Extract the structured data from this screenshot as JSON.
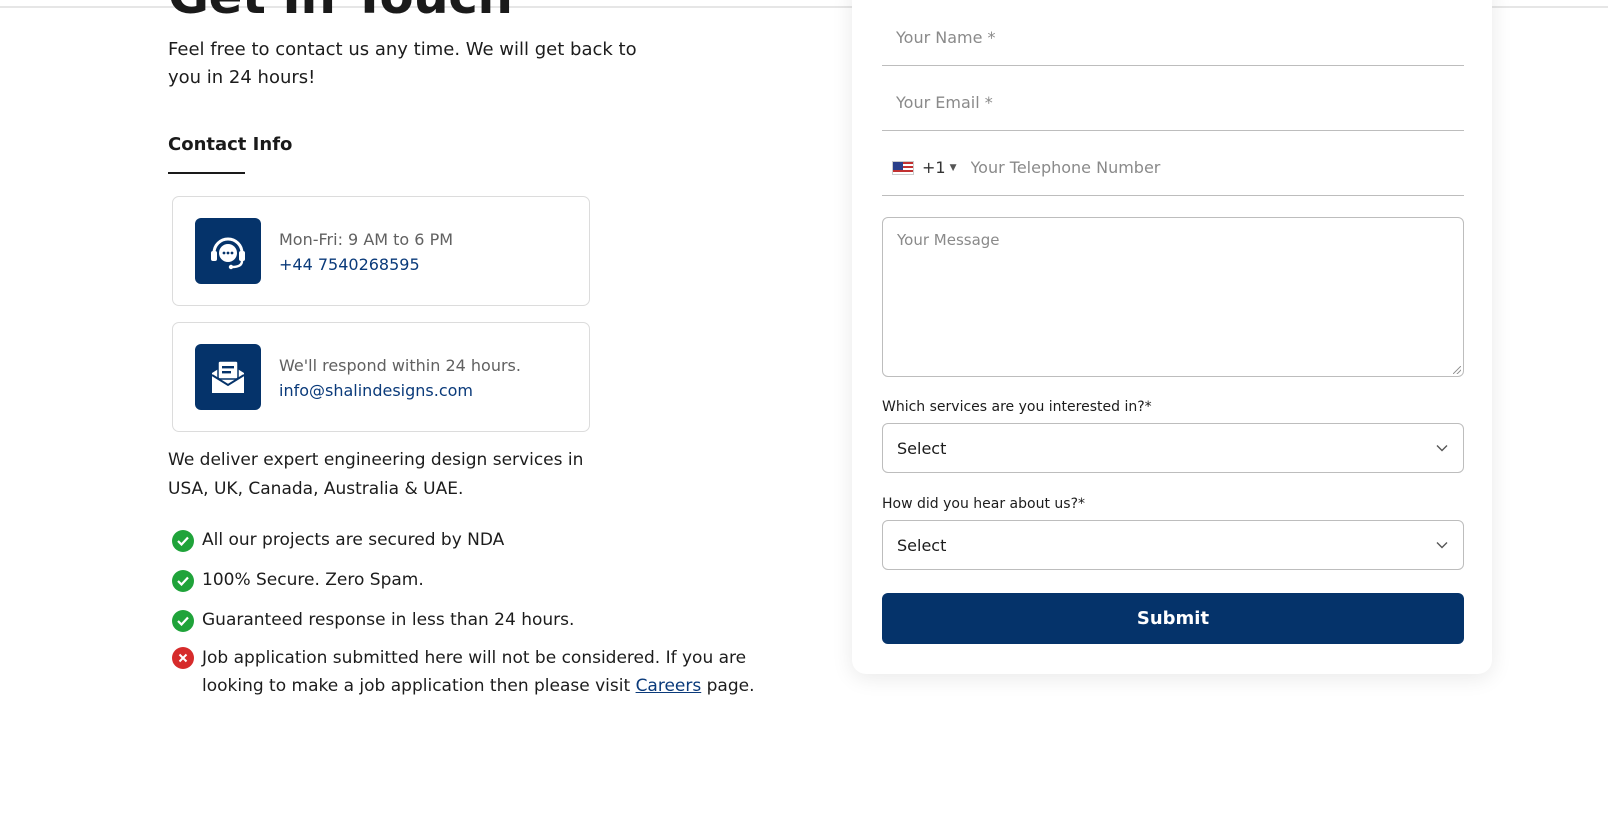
{
  "left": {
    "heading": "Get In Touch",
    "intro": "Feel free to contact us any time. We will get back to you in 24 hours!",
    "contact_info_title": "Contact Info",
    "cards": [
      {
        "icon": "headset-chat-icon",
        "line1": "Mon-Fri: 9 AM to 6 PM",
        "line2": "+44 7540268595"
      },
      {
        "icon": "envelope-open-icon",
        "line1": "We'll respond within 24 hours.",
        "line2": "info@shalindesigns.com"
      }
    ],
    "deliver_text": "We deliver expert engineering design services in USA, UK, Canada, Australia & UAE.",
    "features": [
      "All our projects are secured by NDA",
      "100% Secure. Zero Spam.",
      "Guaranteed response in less than 24 hours."
    ],
    "notice": {
      "before": "Job application submitted here will not be considered. If you are looking to make a job application then please visit ",
      "link": "Careers",
      "after": " page."
    }
  },
  "form": {
    "name_placeholder": "Your Name *",
    "email_placeholder": "Your Email *",
    "phone_dial_code": "+1",
    "phone_placeholder": "Your Telephone Number",
    "message_placeholder": "Your Message",
    "services_label": "Which services are you interested in?*",
    "services_value": "Select",
    "hear_label": "How did you hear about us?*",
    "hear_value": "Select",
    "submit_label": "Submit"
  },
  "colors": {
    "brand": "#05336a",
    "check": "#1fa33a",
    "error": "#d62b2b"
  }
}
